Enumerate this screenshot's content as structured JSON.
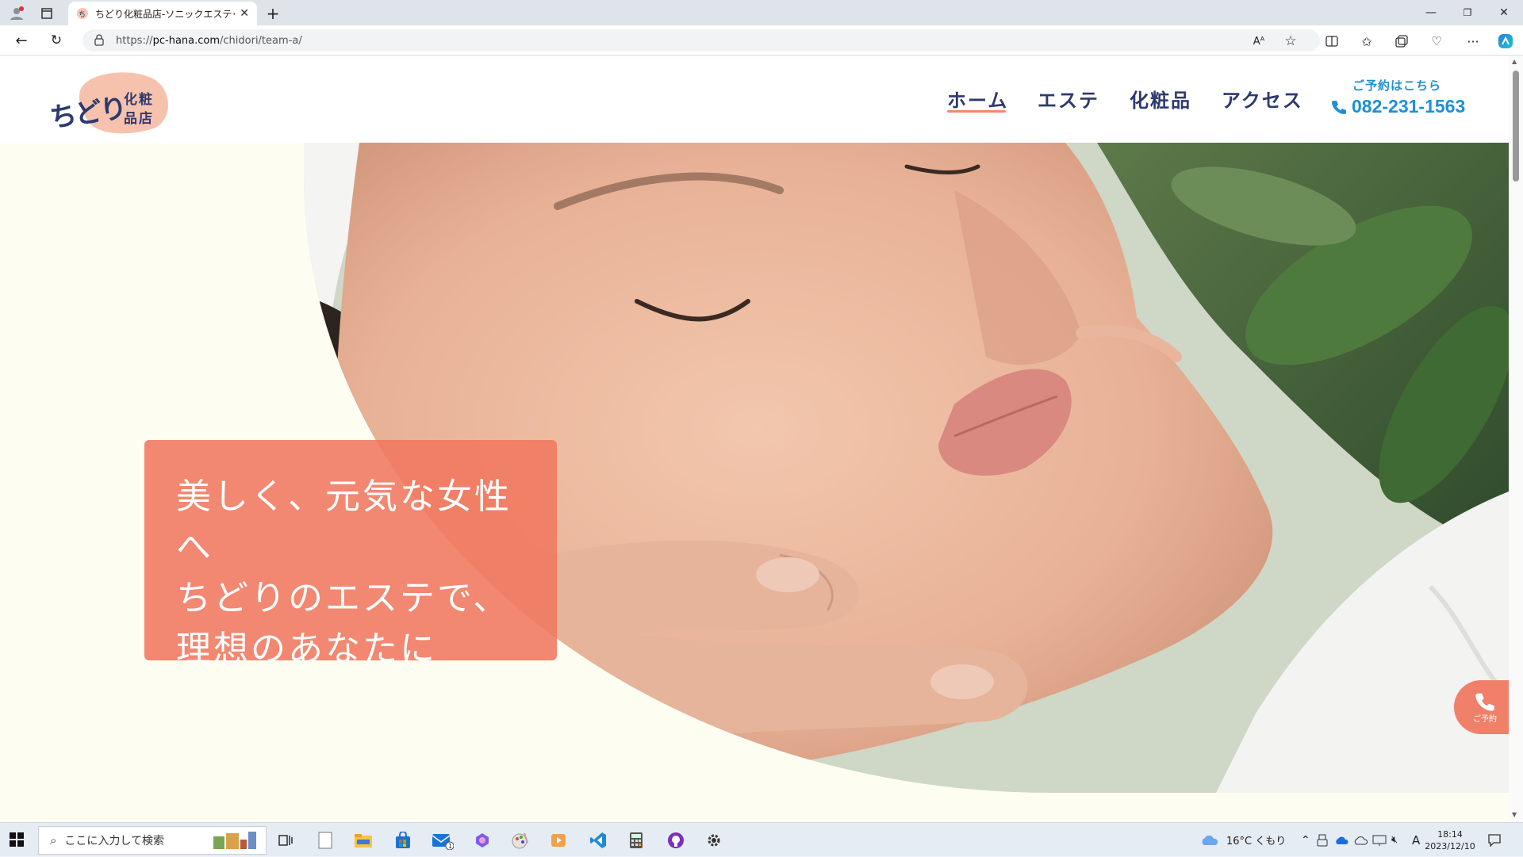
{
  "browser": {
    "tab_title": "ちどり化粧品店-ソニックエステ･化粧",
    "url_prefix": "https://",
    "url_host": "pc-hana.com",
    "url_path": "/chidori/team-a/"
  },
  "site": {
    "logo_text_1": "ちどり",
    "logo_text_2": "化粧",
    "logo_text_3": "品店",
    "nav": [
      {
        "label": "ホーム"
      },
      {
        "label": "エステ"
      },
      {
        "label": "化粧品"
      },
      {
        "label": "アクセス"
      }
    ],
    "reserve_label": "ご予約はこちら",
    "reserve_tel": "082-231-1563",
    "catch_lines": [
      "美しく、元気な女性へ",
      "ちどりのエステで、",
      "理想のあなたに"
    ],
    "float_call_label": "ご予約"
  },
  "taskbar": {
    "search_placeholder": "ここに入力して検索",
    "weather": "16°C くもり",
    "ime": "A",
    "time": "18:14",
    "date": "2023/12/10"
  },
  "colors": {
    "accent_coral": "#f0806a",
    "navy": "#2e3a6e",
    "tel_blue": "#1e8fd6",
    "page_bg": "#fdfdf1"
  }
}
